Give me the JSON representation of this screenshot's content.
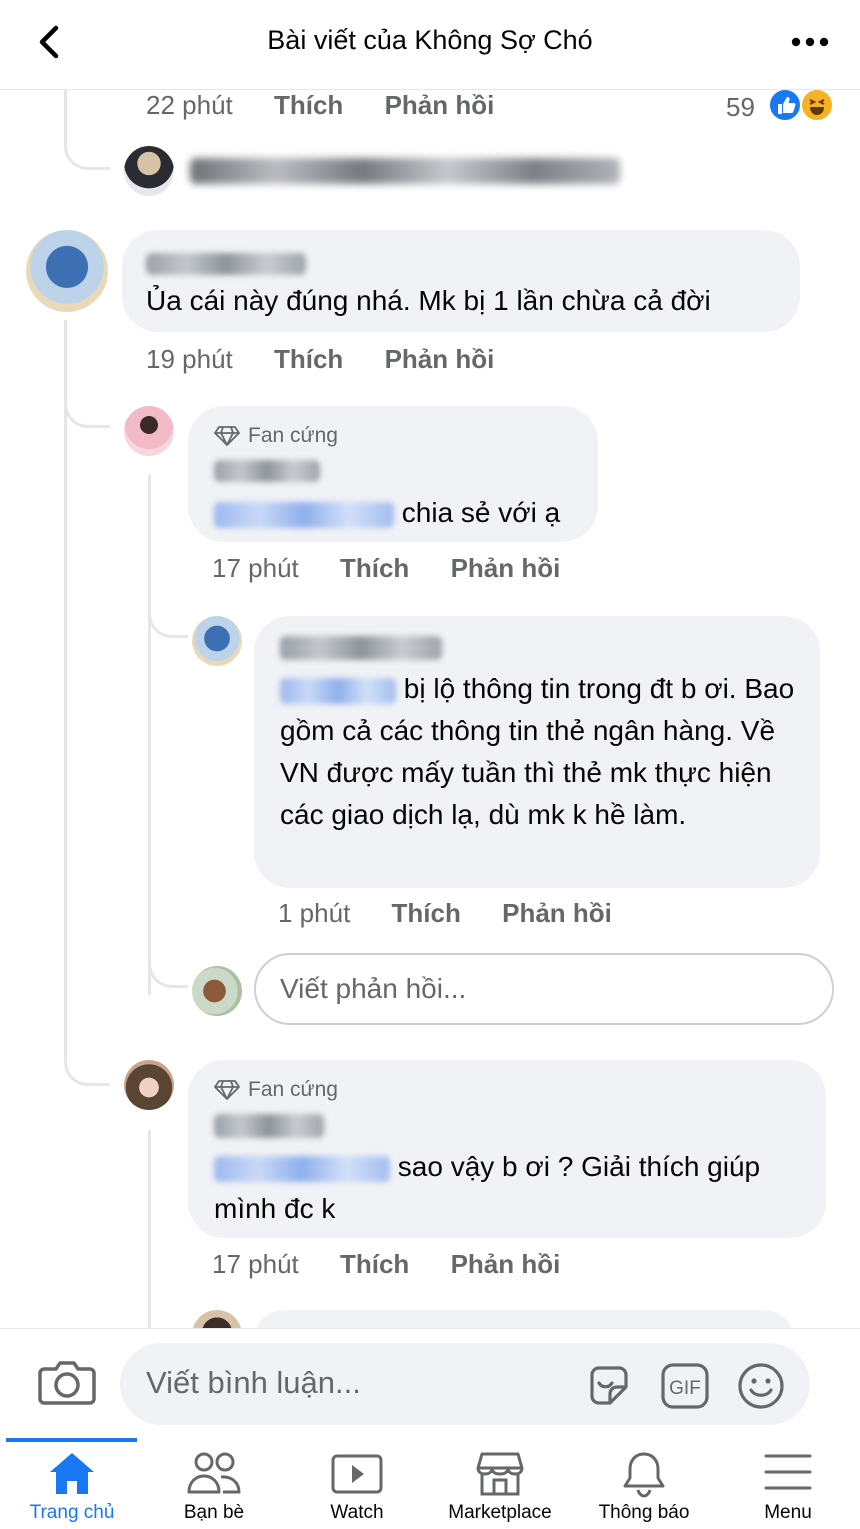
{
  "header": {
    "title": "Bài viết của Không Sợ Chó"
  },
  "top_comment": {
    "time": "22 phút",
    "like": "Thích",
    "reply": "Phản hồi",
    "reaction_count": "59"
  },
  "comments": [
    {
      "text": "Ủa cái này đúng nhá. Mk bị 1 lần chừa cả đời",
      "time": "19 phút",
      "like": "Thích",
      "reply": "Phản hồi"
    },
    {
      "badge": "Fan cứng",
      "text": "chia sẻ với ạ",
      "time": "17 phút",
      "like": "Thích",
      "reply": "Phản hồi"
    },
    {
      "text": "bị lộ thông tin trong đt b ơi.",
      "text_rest": "Bao gồm cả các thông tin thẻ ngân hàng. Về VN được mấy tuần thì thẻ mk thực hiện các giao dịch lạ, dù mk k hề làm.",
      "time": "1 phút",
      "like": "Thích",
      "reply": "Phản hồi"
    },
    {
      "badge": "Fan cứng",
      "text": "sao vậy b ơi ? Giải thích giúp mình đc k",
      "time": "17 phút",
      "like": "Thích",
      "reply": "Phản hồi"
    }
  ],
  "reply_input": {
    "placeholder": "Viết phản hồi..."
  },
  "composer": {
    "placeholder": "Viết bình luận..."
  },
  "nav": [
    {
      "label": "Trang chủ",
      "icon": "home-icon",
      "active": true
    },
    {
      "label": "Bạn bè",
      "icon": "friends-icon"
    },
    {
      "label": "Watch",
      "icon": "watch-icon"
    },
    {
      "label": "Marketplace",
      "icon": "marketplace-icon"
    },
    {
      "label": "Thông báo",
      "icon": "bell-icon"
    },
    {
      "label": "Menu",
      "icon": "menu-icon"
    }
  ],
  "colors": {
    "accent": "#1877f2",
    "bubble": "#f0f2f5",
    "secondary_text": "#65676b",
    "haha": "#f7b125"
  }
}
